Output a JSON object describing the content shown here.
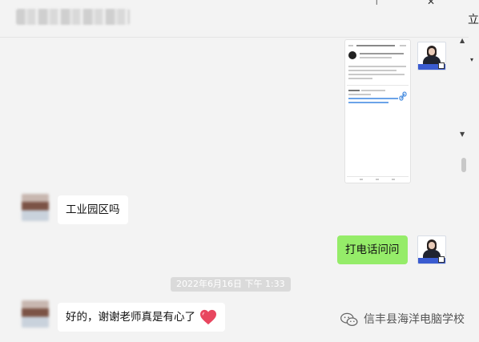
{
  "header": {
    "pin_glyph": "⊤",
    "close_glyph": "✕",
    "side_text": "立",
    "dropdown_glyph": "▾"
  },
  "messages": [
    {
      "id": "m1",
      "side": "left",
      "text": "工业园区吗"
    },
    {
      "id": "m2",
      "side": "right",
      "text": "打电话问问"
    },
    {
      "id": "m3",
      "side": "left",
      "text": "好的，谢谢老师真是有心了"
    }
  ],
  "timestamp": "2022年6月16日 下午 1:33",
  "watermark": "信丰县海洋电脑学校",
  "colors": {
    "sent_bubble": "#95ec69",
    "received_bubble": "#ffffff",
    "heart": "#e8465f"
  },
  "icons": [
    "heart-icon",
    "wechat-icon",
    "scroll-up-icon",
    "scroll-down-icon"
  ]
}
